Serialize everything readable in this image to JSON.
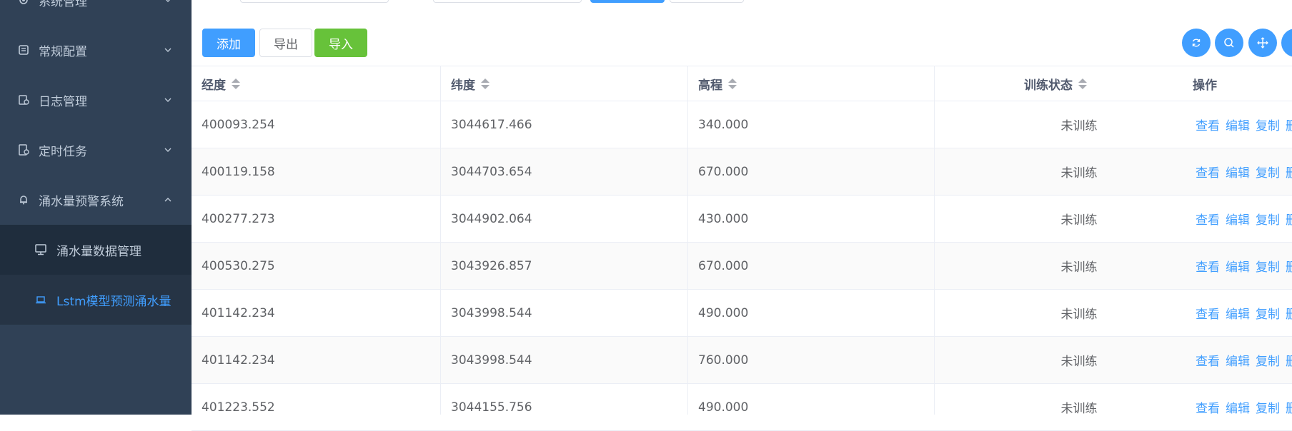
{
  "sidebar": {
    "items": [
      {
        "label": "系统管理",
        "icon": "gear-icon",
        "expanded": false
      },
      {
        "label": "常规配置",
        "icon": "list-icon",
        "expanded": false
      },
      {
        "label": "日志管理",
        "icon": "log-icon",
        "expanded": false
      },
      {
        "label": "定时任务",
        "icon": "schedule-icon",
        "expanded": false
      },
      {
        "label": "涌水量预警系统",
        "icon": "bell-icon",
        "expanded": true
      }
    ],
    "subitems": [
      {
        "label": "涌水量数据管理",
        "icon": "monitor-icon",
        "active": false
      },
      {
        "label": "Lstm模型预测涌水量",
        "icon": "laptop-icon",
        "active": true
      }
    ]
  },
  "toolbar": {
    "add_label": "添加",
    "export_label": "导出",
    "import_label": "导入",
    "right_icons": [
      "refresh-icon",
      "search-icon",
      "move-icon",
      "more-icon"
    ]
  },
  "table": {
    "columns": [
      "经度",
      "纬度",
      "高程",
      "训练状态",
      "操作"
    ],
    "actions": [
      "查看",
      "编辑",
      "复制",
      "删"
    ],
    "rows": [
      {
        "lon": "400093.254",
        "lat": "3044617.466",
        "elev": "340.000",
        "status": "未训练"
      },
      {
        "lon": "400119.158",
        "lat": "3044703.654",
        "elev": "670.000",
        "status": "未训练"
      },
      {
        "lon": "400277.273",
        "lat": "3044902.064",
        "elev": "430.000",
        "status": "未训练"
      },
      {
        "lon": "400530.275",
        "lat": "3043926.857",
        "elev": "670.000",
        "status": "未训练"
      },
      {
        "lon": "401142.234",
        "lat": "3043998.544",
        "elev": "490.000",
        "status": "未训练"
      },
      {
        "lon": "401142.234",
        "lat": "3043998.544",
        "elev": "760.000",
        "status": "未训练"
      },
      {
        "lon": "401223.552",
        "lat": "3044155.756",
        "elev": "490.000",
        "status": "未训练"
      }
    ]
  },
  "colors": {
    "sidebar_bg": "#304156",
    "submenu_bg": "#1f2d3d",
    "active_text": "#409eff",
    "primary": "#409eff",
    "success": "#67c23a"
  }
}
